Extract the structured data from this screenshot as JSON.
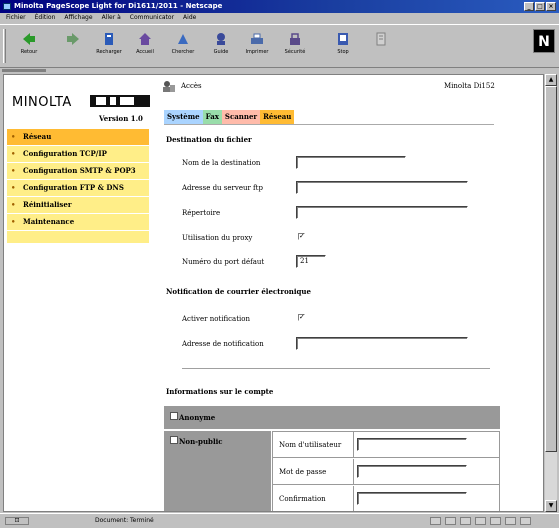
{
  "window": {
    "title": "Minolta PageScope Light for Di1611/2011 - Netscape"
  },
  "menubar": {
    "items": [
      "Fichier",
      "Édition",
      "Affichage",
      "Aller à",
      "Communicator",
      "Aide"
    ]
  },
  "toolbar": {
    "buttons": [
      {
        "label": "Retour",
        "icon": "back-arrow-icon",
        "color": "#2a9a2a"
      },
      {
        "label": "",
        "icon": "forward-arrow-icon",
        "color": "#6a9a6a"
      },
      {
        "label": "Recharger",
        "icon": "reload-icon",
        "color": "#2a5ab8"
      },
      {
        "label": "Accueil",
        "icon": "home-icon",
        "color": "#6a4aa0"
      },
      {
        "label": "Chercher",
        "icon": "search-icon",
        "color": "#3a6ac0"
      },
      {
        "label": "Guide",
        "icon": "guide-icon",
        "color": "#3a4a9a"
      },
      {
        "label": "Imprimer",
        "icon": "print-icon",
        "color": "#4a6aaa"
      },
      {
        "label": "Sécurité",
        "icon": "security-icon",
        "color": "#5a4a8a"
      },
      {
        "label": "Stop",
        "icon": "stop-icon",
        "color": "#3a5ab0"
      },
      {
        "label": "",
        "icon": "doc-icon",
        "color": "#808080"
      }
    ]
  },
  "status": {
    "text": "Document: Terminé"
  },
  "page": {
    "logo": "MINOLTA",
    "version": "Version 1.0",
    "user_label": "Accès",
    "model": "Minolta Di152",
    "nav": [
      {
        "label": "Réseau",
        "active": true
      },
      {
        "label": "Configuration TCP/IP",
        "active": false
      },
      {
        "label": "Configuration SMTP & POP3",
        "active": false
      },
      {
        "label": "Configuration FTP & DNS",
        "active": false
      },
      {
        "label": "Réinitialiser",
        "active": false
      },
      {
        "label": "Maintenance",
        "active": false
      }
    ],
    "tabs": [
      {
        "label": "Système",
        "color": "#aad4ff"
      },
      {
        "label": "Fax",
        "color": "#99ddaa"
      },
      {
        "label": "Scanner",
        "color": "#ffbbaa"
      },
      {
        "label": "Réseau",
        "color": "#ffbb33"
      }
    ],
    "dest": {
      "heading": "Destination du fichier",
      "host_label": "Nom de la destination",
      "host_value": "",
      "ftp_label": "Adresse du serveur ftp",
      "ftp_value": "",
      "dir_label": "Répertoire",
      "dir_value": "",
      "proxy_label": "Utilisation du proxy",
      "proxy_check": "✓",
      "port_label": "Numéro du port défaut",
      "port_value": "21"
    },
    "notify": {
      "heading": "Notification de courrier électronique",
      "enable_label": "Activer notification",
      "enable_check": "✓",
      "address_label": "Adresse de notification",
      "address_value": ""
    },
    "account": {
      "heading": "Informations sur le compte",
      "anon_label": "Anonyme",
      "other_label": "Non-public",
      "user_label": "Nom d'utilisateur",
      "pass_label": "Mot de passe",
      "confirm_label": "Confirmation"
    }
  }
}
